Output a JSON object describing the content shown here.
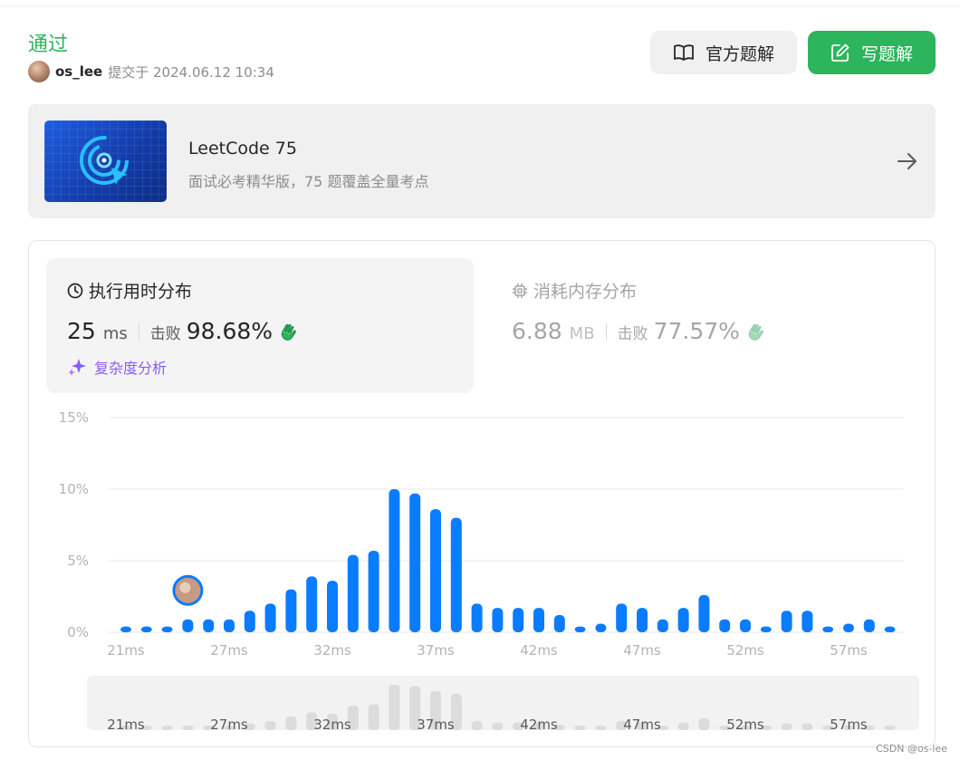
{
  "header": {
    "status": "通过",
    "username": "os_lee",
    "submitted_text": "提交于 2024.06.12 10:34",
    "official_solution_label": "官方题解",
    "write_solution_label": "写题解"
  },
  "banner": {
    "title": "LeetCode 75",
    "subtitle": "面试必考精华版，75 题覆盖全量考点"
  },
  "runtime": {
    "title": "执行用时分布",
    "value": "25",
    "unit": "ms",
    "beat_label": "击败",
    "beat_percent": "98.68%",
    "complexity_label": "复杂度分析"
  },
  "memory": {
    "title": "消耗内存分布",
    "value": "6.88",
    "unit": "MB",
    "beat_label": "击败",
    "beat_percent": "77.57%"
  },
  "colors": {
    "accent_green": "#2cb55d",
    "bar_blue": "#0a7cff",
    "purple": "#8a5cf5"
  },
  "chart_data": {
    "type": "bar",
    "xlabel": "",
    "ylabel": "",
    "ylim": [
      0,
      15
    ],
    "y_ticks": [
      "15%",
      "10%",
      "5%",
      "0%"
    ],
    "x_tick_labels": [
      "21ms",
      "27ms",
      "32ms",
      "37ms",
      "42ms",
      "47ms",
      "52ms",
      "57ms"
    ],
    "x_tick_indices": [
      0,
      5,
      10,
      15,
      20,
      25,
      30,
      35
    ],
    "user_bar_index": 3,
    "grid": true,
    "values": [
      0.4,
      0.4,
      0.4,
      0.9,
      0.9,
      0.9,
      1.5,
      2.0,
      3.0,
      3.9,
      3.6,
      5.4,
      5.7,
      10.0,
      9.7,
      8.6,
      8.0,
      2.0,
      1.7,
      1.7,
      1.7,
      1.2,
      0.4,
      0.6,
      2.0,
      1.7,
      0.9,
      1.7,
      2.6,
      0.9,
      0.9,
      0.4,
      1.5,
      1.5,
      0.4,
      0.6,
      0.9,
      0.4
    ]
  },
  "watermark": "CSDN @os-lee"
}
